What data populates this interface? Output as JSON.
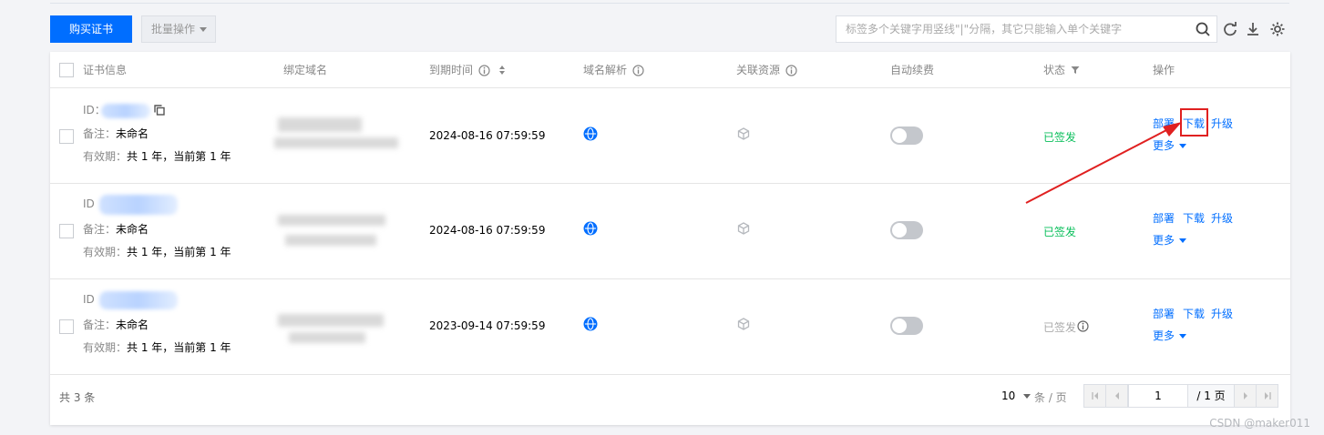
{
  "toolbar": {
    "buy_label": "购买证书",
    "batch_label": "批量操作",
    "search_placeholder": "标签多个关键字用竖线\"|\"分隔，其它只能输入单个关键字"
  },
  "columns": {
    "cert_info": "证书信息",
    "domain": "绑定域名",
    "expire": "到期时间",
    "dns": "域名解析",
    "resource": "关联资源",
    "auto_renew": "自动续费",
    "status": "状态",
    "ops": "操作"
  },
  "rows": [
    {
      "id_label": "ID：",
      "note_label": "备注：",
      "note_value": "未命名",
      "validity_label": "有效期：",
      "validity_value": "共 1 年，当前第 1 年",
      "expire": "2024-08-16 07:59:59",
      "status": "已签发",
      "deploy": "部署",
      "download": "下载",
      "upgrade": "升级",
      "more": "更多"
    },
    {
      "id_label": "ID",
      "note_label": "备注：",
      "note_value": "未命名",
      "validity_label": "有效期：",
      "validity_value": "共 1 年，当前第 1 年",
      "expire": "2024-08-16 07:59:59",
      "status": "已签发",
      "deploy": "部署",
      "download": "下载",
      "upgrade": "升级",
      "more": "更多"
    },
    {
      "id_label": "ID",
      "note_label": "备注：",
      "note_value": "未命名",
      "validity_label": "有效期：",
      "validity_value": "共 1 年，当前第 1 年",
      "expire": "2023-09-14 07:59:59",
      "status": "已签发",
      "deploy": "部署",
      "download": "下载",
      "upgrade": "升级",
      "more": "更多"
    }
  ],
  "footer": {
    "total": "共 3 条",
    "page_size": "10",
    "per_page": "条 / 页",
    "page_input": "1",
    "page_total": "/ 1 页"
  },
  "watermark": "CSDN @maker011",
  "colors": {
    "accent": "#006eff",
    "success": "#0abf5b",
    "annotation": "#e02020"
  }
}
